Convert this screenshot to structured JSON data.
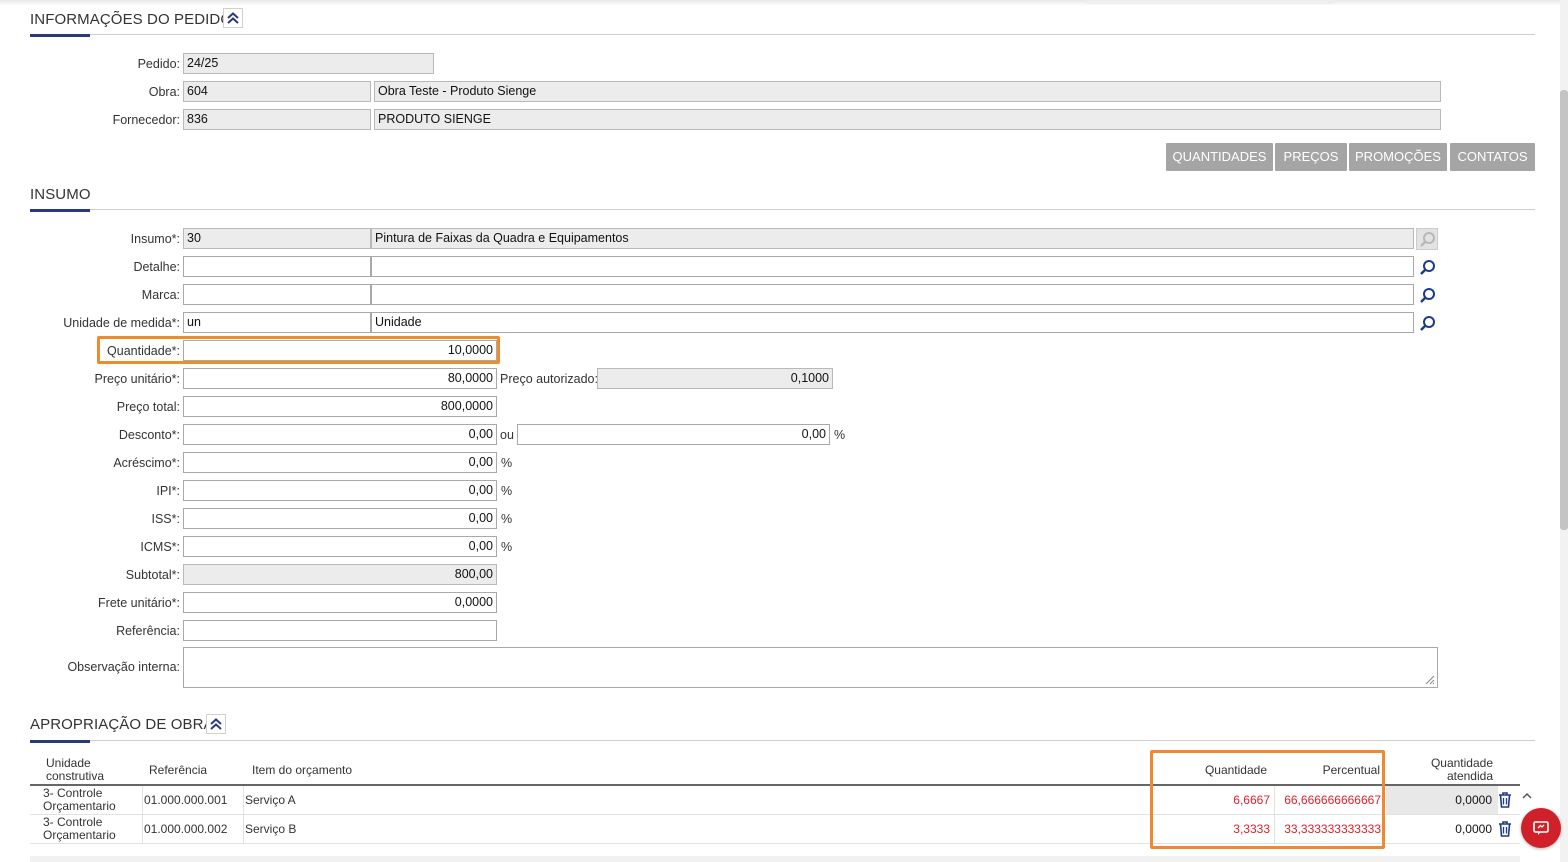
{
  "colors": {
    "accent": "#2b3a7a",
    "highlight": "#f08a2f",
    "tab_bg": "#a5a5a5",
    "negative_red": "#e01e2a",
    "chat_red": "#d0202a"
  },
  "order_info": {
    "title": "INFORMAÇÕES DO PEDIDO",
    "pedido_label": "Pedido:",
    "pedido_value": "24/25",
    "obra_label": "Obra:",
    "obra_code": "604",
    "obra_name": "Obra Teste - Produto Sienge",
    "fornecedor_label": "Fornecedor:",
    "fornecedor_code": "836",
    "fornecedor_name": "PRODUTO SIENGE"
  },
  "tabs": [
    {
      "label": "QUANTIDADES"
    },
    {
      "label": "PREÇOS"
    },
    {
      "label": "PROMOÇÕES"
    },
    {
      "label": "CONTATOS"
    }
  ],
  "insumo": {
    "title": "INSUMO",
    "insumo_label": "Insumo*:",
    "insumo_code": "30",
    "insumo_name": "Pintura de Faixas da Quadra e Equipamentos",
    "detalhe_label": "Detalhe:",
    "detalhe_code": "",
    "detalhe_name": "",
    "marca_label": "Marca:",
    "marca_code": "",
    "marca_name": "",
    "unidade_label": "Unidade de medida*:",
    "unidade_code": "un",
    "unidade_name": "Unidade",
    "quantidade_label": "Quantidade*:",
    "quantidade_value": "10,0000",
    "preco_unit_label": "Preço unitário*:",
    "preco_unit_value": "80,0000",
    "preco_aut_label": "Preço autorizado:",
    "preco_aut_value": "0,1000",
    "preco_total_label": "Preço total:",
    "preco_total_value": "800,0000",
    "desconto_label": "Desconto*:",
    "desconto_value": "0,00",
    "ou_label": "ou",
    "desconto_pct_value": "0,00",
    "acrescimo_label": "Acréscimo*:",
    "acrescimo_value": "0,00",
    "ipi_label": "IPI*:",
    "ipi_value": "0,00",
    "iss_label": "ISS*:",
    "iss_value": "0,00",
    "icms_label": "ICMS*:",
    "icms_value": "0,00",
    "subtotal_label": "Subtotal*:",
    "subtotal_value": "800,00",
    "frete_label": "Frete unitário*:",
    "frete_value": "0,0000",
    "referencia_label": "Referência:",
    "referencia_value": "",
    "observacao_label": "Observação interna:",
    "percent_sign": "%"
  },
  "apropriacao": {
    "title": "APROPRIAÇÃO DE OBRA",
    "headers": {
      "unidade_l1": "Unidade",
      "unidade_l2": "construtiva",
      "referencia": "Referência",
      "item": "Item do orçamento",
      "quantidade": "Quantidade",
      "percentual": "Percentual",
      "qtd_atendida_l1": "Quantidade",
      "qtd_atendida_l2": "atendida"
    },
    "rows": [
      {
        "unidade_l1": "3- Controle",
        "unidade_l2": "Orçamentario",
        "referencia": "01.000.000.001",
        "item": "Serviço A",
        "quantidade": "6,6667",
        "percentual": "66,666666666667",
        "qtd_atendida": "0,0000"
      },
      {
        "unidade_l1": "3- Controle",
        "unidade_l2": "Orçamentario",
        "referencia": "01.000.000.002",
        "item": "Serviço B",
        "quantidade": "3,3333",
        "percentual": "33,333333333333",
        "qtd_atendida": "0,0000"
      }
    ]
  }
}
